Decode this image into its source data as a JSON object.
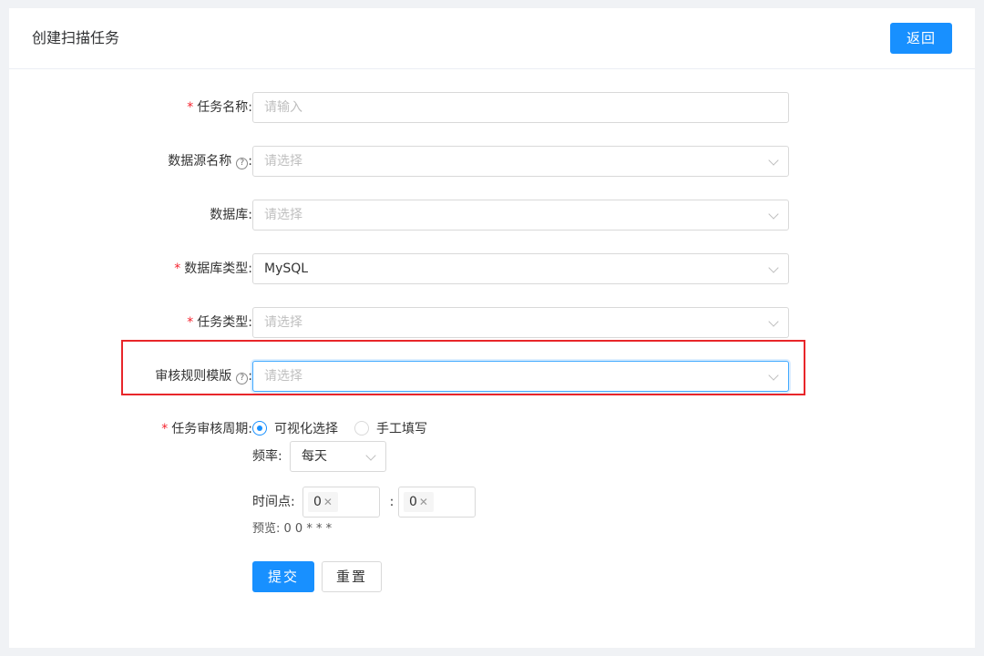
{
  "header": {
    "title": "创建扫描任务",
    "back_label": "返回"
  },
  "form": {
    "task_name": {
      "label": "任务名称:",
      "required": true,
      "placeholder": "请输入"
    },
    "datasource_name": {
      "label": "数据源名称",
      "colon": ":",
      "placeholder": "请选择"
    },
    "database": {
      "label": "数据库:",
      "placeholder": "请选择"
    },
    "database_type": {
      "label": "数据库类型:",
      "required": true,
      "value": "MySQL"
    },
    "task_type": {
      "label": "任务类型:",
      "required": true,
      "placeholder": "请选择"
    },
    "audit_template": {
      "label": "审核规则模版",
      "colon": ":",
      "placeholder": "请选择",
      "highlighted": true
    },
    "audit_cycle": {
      "label": "任务审核周期:",
      "required": true,
      "options": [
        {
          "label": "可视化选择",
          "selected": true
        },
        {
          "label": "手工填写",
          "selected": false
        }
      ],
      "frequency_label": "频率:",
      "frequency_value": "每天",
      "time_label": "时间点:",
      "hour_tag": "0",
      "minute_tag": "0",
      "separator": ":",
      "preview": "预览: 0 0 * * *"
    },
    "submit_label": "提交",
    "reset_label": "重置"
  },
  "icons": {
    "help": "question-circle-icon",
    "dropdown": "chevron-down-icon",
    "remove": "close-icon"
  },
  "colors": {
    "primary": "#1890ff",
    "required": "#f5222d",
    "highlight": "#e8262a"
  }
}
